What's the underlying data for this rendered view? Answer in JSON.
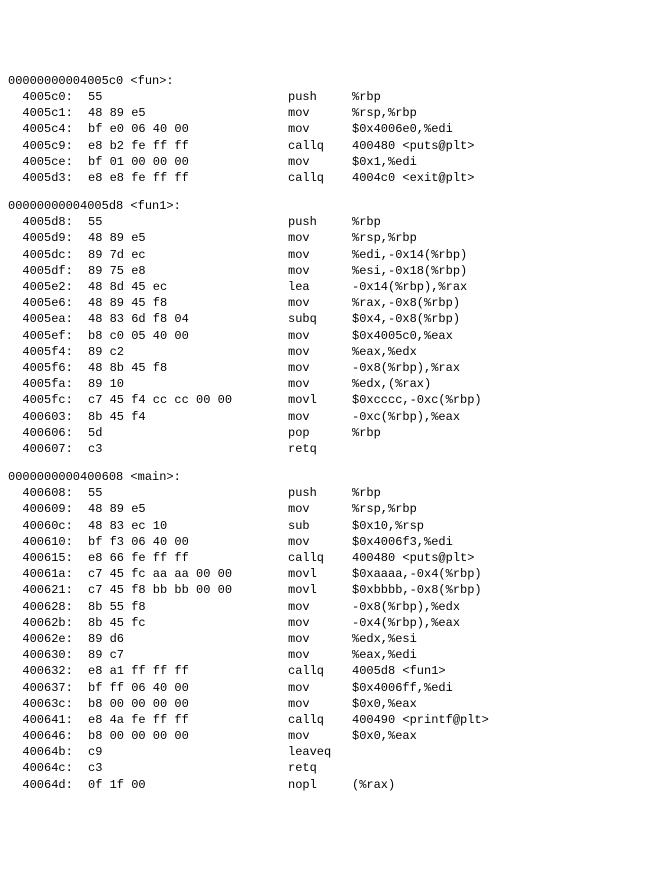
{
  "sections": [
    {
      "header": "00000000004005c0 <fun>:",
      "lines": [
        {
          "addr": "4005c0:",
          "bytes": "55",
          "mnem": "push",
          "ops": "%rbp"
        },
        {
          "addr": "4005c1:",
          "bytes": "48 89 e5",
          "mnem": "mov",
          "ops": "%rsp,%rbp"
        },
        {
          "addr": "4005c4:",
          "bytes": "bf e0 06 40 00",
          "mnem": "mov",
          "ops": "$0x4006e0,%edi"
        },
        {
          "addr": "4005c9:",
          "bytes": "e8 b2 fe ff ff",
          "mnem": "callq",
          "ops": "400480 <puts@plt>"
        },
        {
          "addr": "4005ce:",
          "bytes": "bf 01 00 00 00",
          "mnem": "mov",
          "ops": "$0x1,%edi"
        },
        {
          "addr": "4005d3:",
          "bytes": "e8 e8 fe ff ff",
          "mnem": "callq",
          "ops": "4004c0 <exit@plt>"
        }
      ]
    },
    {
      "header": "00000000004005d8 <fun1>:",
      "lines": [
        {
          "addr": "4005d8:",
          "bytes": "55",
          "mnem": "push",
          "ops": "%rbp"
        },
        {
          "addr": "4005d9:",
          "bytes": "48 89 e5",
          "mnem": "mov",
          "ops": "%rsp,%rbp"
        },
        {
          "addr": "4005dc:",
          "bytes": "89 7d ec",
          "mnem": "mov",
          "ops": "%edi,-0x14(%rbp)"
        },
        {
          "addr": "4005df:",
          "bytes": "89 75 e8",
          "mnem": "mov",
          "ops": "%esi,-0x18(%rbp)"
        },
        {
          "addr": "4005e2:",
          "bytes": "48 8d 45 ec",
          "mnem": "lea",
          "ops": "-0x14(%rbp),%rax"
        },
        {
          "addr": "4005e6:",
          "bytes": "48 89 45 f8",
          "mnem": "mov",
          "ops": "%rax,-0x8(%rbp)"
        },
        {
          "addr": "4005ea:",
          "bytes": "48 83 6d f8 04",
          "mnem": "subq",
          "ops": "$0x4,-0x8(%rbp)"
        },
        {
          "addr": "4005ef:",
          "bytes": "b8 c0 05 40 00",
          "mnem": "mov",
          "ops": "$0x4005c0,%eax"
        },
        {
          "addr": "4005f4:",
          "bytes": "89 c2",
          "mnem": "mov",
          "ops": "%eax,%edx"
        },
        {
          "addr": "4005f6:",
          "bytes": "48 8b 45 f8",
          "mnem": "mov",
          "ops": "-0x8(%rbp),%rax"
        },
        {
          "addr": "4005fa:",
          "bytes": "89 10",
          "mnem": "mov",
          "ops": "%edx,(%rax)"
        },
        {
          "addr": "4005fc:",
          "bytes": "c7 45 f4 cc cc 00 00",
          "mnem": "movl",
          "ops": "$0xcccc,-0xc(%rbp)"
        },
        {
          "addr": "400603:",
          "bytes": "8b 45 f4",
          "mnem": "mov",
          "ops": "-0xc(%rbp),%eax"
        },
        {
          "addr": "400606:",
          "bytes": "5d",
          "mnem": "pop",
          "ops": "%rbp"
        },
        {
          "addr": "400607:",
          "bytes": "c3",
          "mnem": "retq",
          "ops": ""
        }
      ]
    },
    {
      "header": "0000000000400608 <main>:",
      "lines": [
        {
          "addr": "400608:",
          "bytes": "55",
          "mnem": "push",
          "ops": "%rbp"
        },
        {
          "addr": "400609:",
          "bytes": "48 89 e5",
          "mnem": "mov",
          "ops": "%rsp,%rbp"
        },
        {
          "addr": "40060c:",
          "bytes": "48 83 ec 10",
          "mnem": "sub",
          "ops": "$0x10,%rsp"
        },
        {
          "addr": "400610:",
          "bytes": "bf f3 06 40 00",
          "mnem": "mov",
          "ops": "$0x4006f3,%edi"
        },
        {
          "addr": "400615:",
          "bytes": "e8 66 fe ff ff",
          "mnem": "callq",
          "ops": "400480 <puts@plt>"
        },
        {
          "addr": "40061a:",
          "bytes": "c7 45 fc aa aa 00 00",
          "mnem": "movl",
          "ops": "$0xaaaa,-0x4(%rbp)"
        },
        {
          "addr": "400621:",
          "bytes": "c7 45 f8 bb bb 00 00",
          "mnem": "movl",
          "ops": "$0xbbbb,-0x8(%rbp)"
        },
        {
          "addr": "400628:",
          "bytes": "8b 55 f8",
          "mnem": "mov",
          "ops": "-0x8(%rbp),%edx"
        },
        {
          "addr": "40062b:",
          "bytes": "8b 45 fc",
          "mnem": "mov",
          "ops": "-0x4(%rbp),%eax"
        },
        {
          "addr": "40062e:",
          "bytes": "89 d6",
          "mnem": "mov",
          "ops": "%edx,%esi"
        },
        {
          "addr": "400630:",
          "bytes": "89 c7",
          "mnem": "mov",
          "ops": "%eax,%edi"
        },
        {
          "addr": "400632:",
          "bytes": "e8 a1 ff ff ff",
          "mnem": "callq",
          "ops": "4005d8 <fun1>"
        },
        {
          "addr": "400637:",
          "bytes": "bf ff 06 40 00",
          "mnem": "mov",
          "ops": "$0x4006ff,%edi"
        },
        {
          "addr": "40063c:",
          "bytes": "b8 00 00 00 00",
          "mnem": "mov",
          "ops": "$0x0,%eax"
        },
        {
          "addr": "400641:",
          "bytes": "e8 4a fe ff ff",
          "mnem": "callq",
          "ops": "400490 <printf@plt>"
        },
        {
          "addr": "400646:",
          "bytes": "b8 00 00 00 00",
          "mnem": "mov",
          "ops": "$0x0,%eax"
        },
        {
          "addr": "40064b:",
          "bytes": "c9",
          "mnem": "leaveq",
          "ops": ""
        },
        {
          "addr": "40064c:",
          "bytes": "c3",
          "mnem": "retq",
          "ops": ""
        },
        {
          "addr": "40064d:",
          "bytes": "0f 1f 00",
          "mnem": "nopl",
          "ops": "(%rax)"
        }
      ]
    }
  ]
}
